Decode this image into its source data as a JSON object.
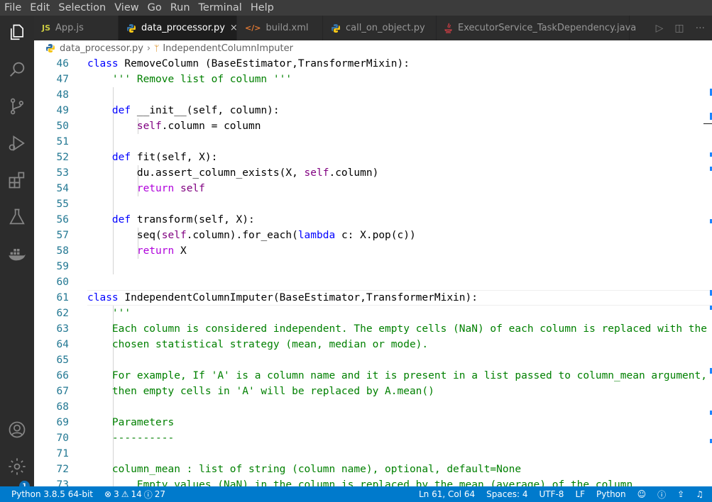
{
  "menubar": {
    "items": [
      "File",
      "Edit",
      "Selection",
      "View",
      "Go",
      "Run",
      "Terminal",
      "Help"
    ]
  },
  "tabs": [
    {
      "label": "App.js",
      "icon": "js-icon",
      "icon_text": "JS",
      "active": false
    },
    {
      "label": "data_processor.py",
      "icon": "python-icon",
      "active": true,
      "close": "×"
    },
    {
      "label": "build.xml",
      "icon": "xml-icon",
      "icon_text": "</>",
      "active": false
    },
    {
      "label": "call_on_object.py",
      "icon": "python-icon",
      "active": false
    },
    {
      "label": "ExecutorService_TaskDependency.java",
      "icon": "java-icon",
      "active": false
    }
  ],
  "breadcrumb": {
    "file": "data_processor.py",
    "symbol": "IndependentColumnImputer"
  },
  "editor": {
    "line_numbers": [
      "46",
      "47",
      "48",
      "49",
      "50",
      "51",
      "52",
      "53",
      "54",
      "55",
      "56",
      "57",
      "58",
      "59",
      "60",
      "61",
      "62",
      "63",
      "64",
      "65",
      "66",
      "67",
      "68",
      "69",
      "70",
      "71",
      "72",
      "73"
    ]
  },
  "statusbar": {
    "interpreter": "Python 3.8.5 64-bit",
    "errors": "3",
    "warnings": "14",
    "infos": "27",
    "position": "Ln 61, Col 64",
    "spaces": "Spaces: 4",
    "encoding": "UTF-8",
    "eol": "LF",
    "language": "Python"
  },
  "activity_badge": "1",
  "colors": {
    "accent": "#007acc",
    "keyword": "#0000ff",
    "self": "#800080",
    "string": "#008000",
    "line_number": "#237893"
  }
}
